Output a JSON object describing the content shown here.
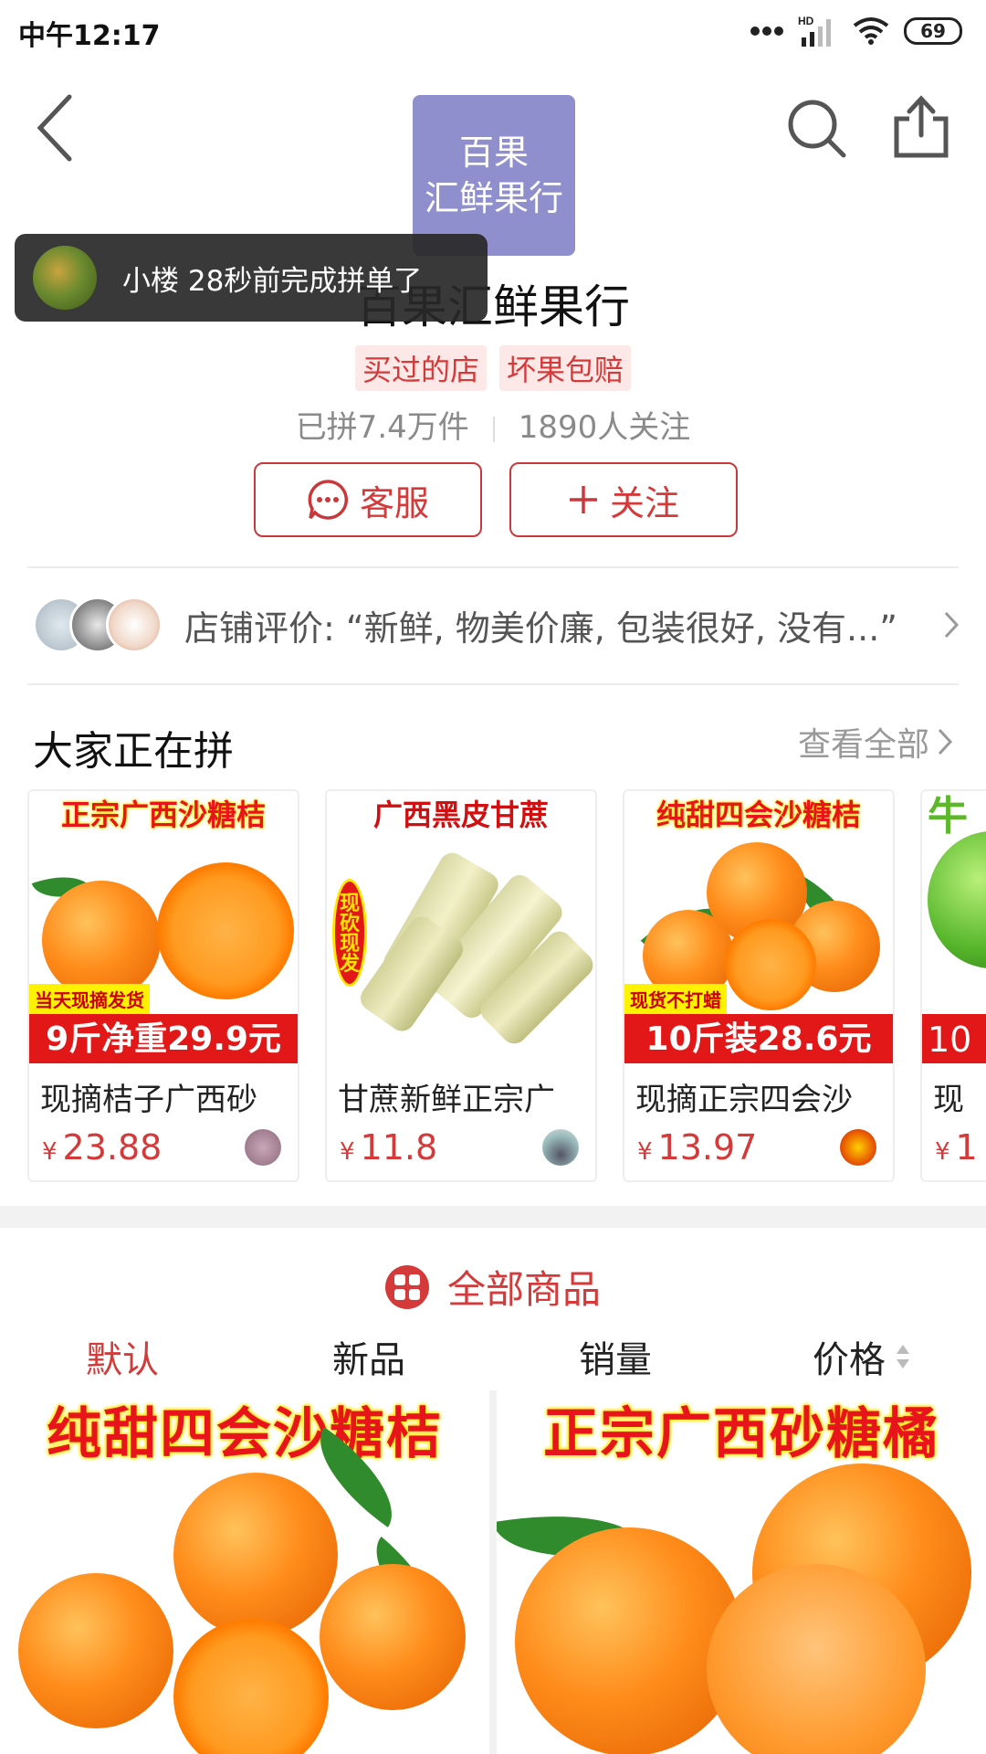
{
  "status_bar": {
    "time": "中午12:17",
    "network": "HD",
    "battery": "69"
  },
  "header": {
    "logo_text_line1": "百果",
    "logo_text_line2": "汇鲜果行"
  },
  "toast": {
    "text": "小楼 28秒前完成拼单了"
  },
  "store": {
    "name": "百果汇鲜果行",
    "tags": [
      "买过的店",
      "坏果包赔"
    ],
    "sold": "已拼7.4万件",
    "followers": "1890人关注"
  },
  "actions": {
    "service_label": "客服",
    "follow_label": "关注"
  },
  "review": {
    "text": "店铺评价: “新鲜, 物美价廉, 包装很好, 没有...”"
  },
  "group_buy": {
    "title": "大家正在拼",
    "view_all": "查看全部",
    "products": [
      {
        "banner": "正宗广西沙糖桔",
        "sub": "当天现摘发货",
        "promo": "9斤净重29.9元",
        "title": "现摘桔子广西砂",
        "currency": "¥",
        "price": "23.88"
      },
      {
        "banner": "广西黑皮甘蔗",
        "sub": "现砍现发",
        "promo": "",
        "title": "甘蔗新鲜正宗广",
        "currency": "¥",
        "price": "11.8"
      },
      {
        "banner": "纯甜四会沙糖桔",
        "sub": "现货不打蜡",
        "promo": "10斤装28.6元",
        "title": "现摘正宗四会沙",
        "currency": "¥",
        "price": "13.97"
      },
      {
        "banner": "牛",
        "sub": "",
        "promo": "10",
        "title": "现",
        "currency": "¥",
        "price": "1"
      }
    ]
  },
  "all_products": {
    "title": "全部商品",
    "sort_tabs": [
      "默认",
      "新品",
      "销量",
      "价格"
    ],
    "items": [
      {
        "banner": "纯甜四会沙糖桔"
      },
      {
        "banner": "正宗广西砂糖橘"
      }
    ]
  },
  "colors": {
    "accent": "#d43a3a",
    "logo_bg": "#8e8fcc"
  }
}
